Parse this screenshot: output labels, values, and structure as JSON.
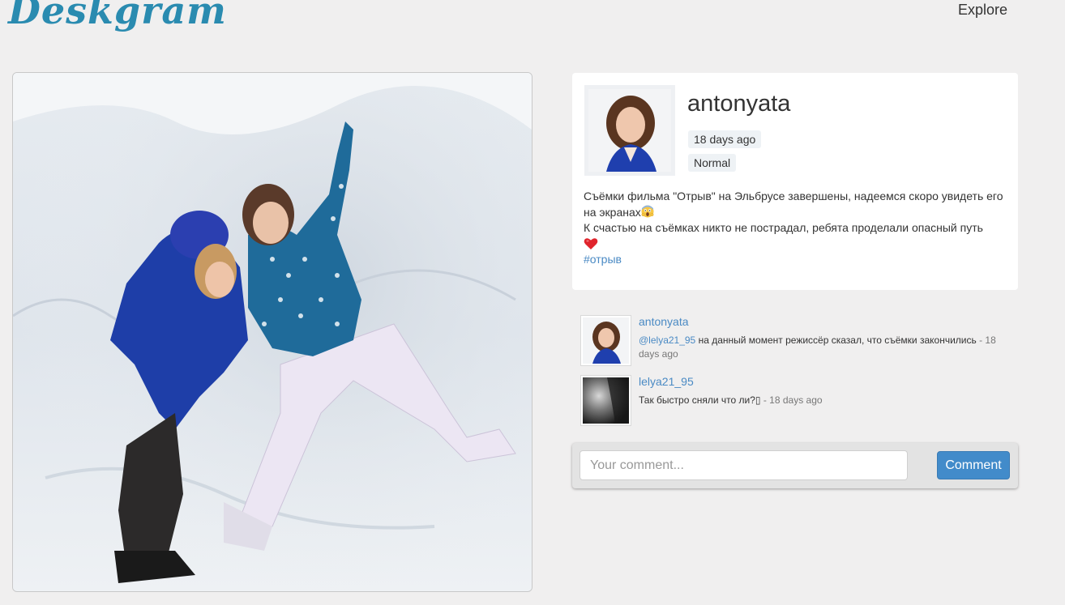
{
  "header": {
    "logo_text": "Deskgram",
    "nav_explore": "Explore"
  },
  "post": {
    "username": "antonyata",
    "time_ago": "18 days ago",
    "filter": "Normal",
    "caption_line1": "Съёмки фильма \"Отрыв\" на Эльбрусе завершены, надеемся скоро увидеть его на экранах",
    "caption_line2": "К счастью на съёмках никто не пострадал, ребята проделали опасный путь",
    "hashtag": "#отрыв",
    "photo_alt_icon": "snow-photo"
  },
  "comments": [
    {
      "username": "antonyata",
      "mention": "@lelya21_95",
      "text": " на данный момент режиссёр сказал, что съёмки закончились",
      "time": " - 18 days ago"
    },
    {
      "username": "lelya21_95",
      "mention": "",
      "text": "Так быстро сняли что ли?▯",
      "time": " - 18 days ago"
    }
  ],
  "comment_form": {
    "placeholder": "Your comment...",
    "button_label": "Comment"
  },
  "colors": {
    "brand": "#2a8bb0",
    "link": "#4a8ac4",
    "button": "#428bca",
    "background": "#f0efef"
  }
}
